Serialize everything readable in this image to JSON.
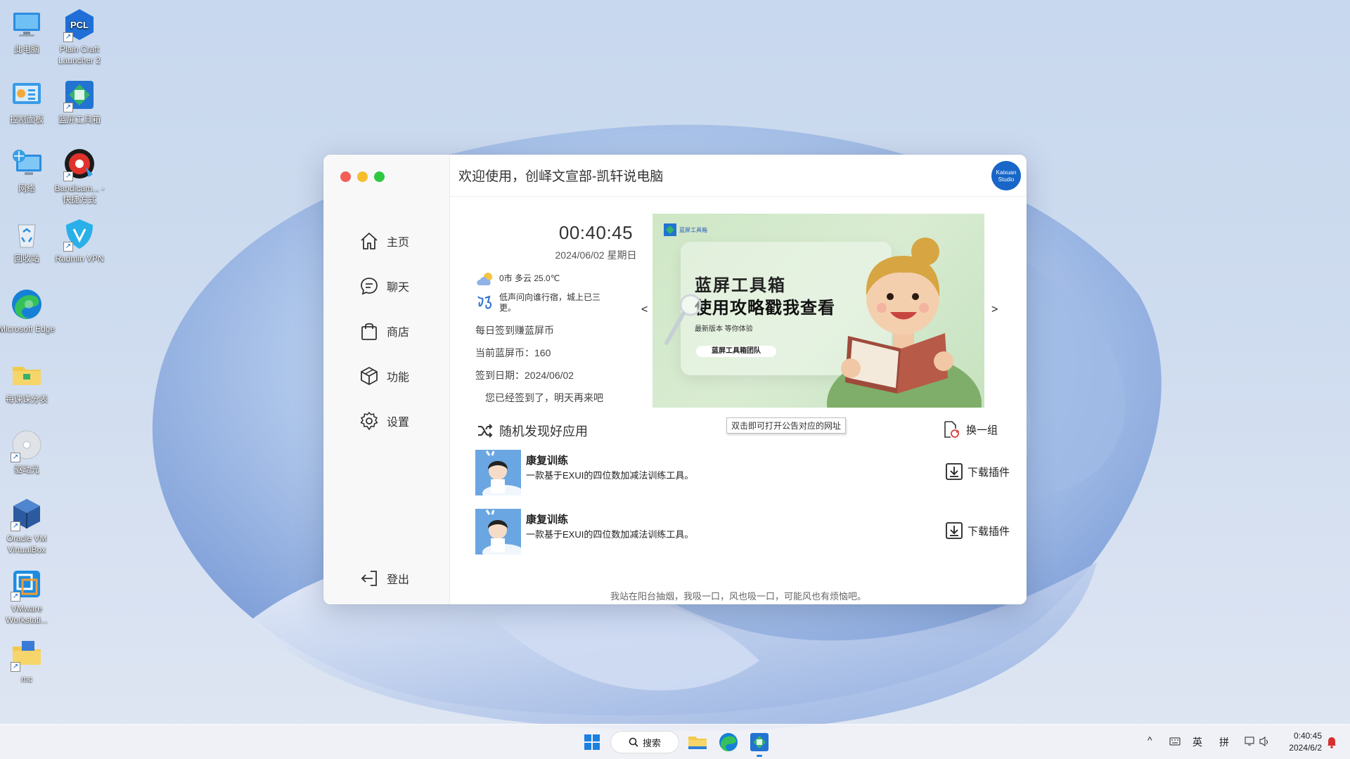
{
  "desktop": {
    "icons": [
      {
        "label": "此电脑",
        "icon": "computer-icon"
      },
      {
        "label": "Plain Craft Launcher 2",
        "icon": "pcl-icon",
        "badge": "PCL"
      },
      {
        "label": "控制面板",
        "icon": "control-panel-icon"
      },
      {
        "label": "蓝屏工具箱",
        "icon": "toolbox-icon"
      },
      {
        "label": "网络",
        "icon": "network-icon"
      },
      {
        "label": "Bandicam... - 快捷方式",
        "icon": "bandicam-icon"
      },
      {
        "label": "回收站",
        "icon": "recycle-bin-icon"
      },
      {
        "label": "Radmin VPN",
        "icon": "radmin-vpn-icon"
      },
      {
        "label": "Microsoft Edge",
        "icon": "edge-icon"
      },
      {
        "label": "每课课分表",
        "icon": "folder-icon"
      },
      {
        "label": "驱动光",
        "icon": "disc-icon"
      },
      {
        "label": "Oracle VM VirtualBox",
        "icon": "virtualbox-icon"
      },
      {
        "label": "VMware Workstati...",
        "icon": "vmware-icon"
      },
      {
        "label": "mc",
        "icon": "mc-folder-icon"
      }
    ]
  },
  "window": {
    "header_title": "欢迎使用，创峄文宣部-凯轩说电脑",
    "avatar_text": "Kaixuan Studio",
    "traffic_colors": [
      "#f25f57",
      "#f6be2e",
      "#2ec840"
    ],
    "nav": [
      {
        "label": "主页",
        "icon": "home-icon"
      },
      {
        "label": "聊天",
        "icon": "chat-icon"
      },
      {
        "label": "商店",
        "icon": "shopping-bag-icon"
      },
      {
        "label": "功能",
        "icon": "cube-icon"
      },
      {
        "label": "设置",
        "icon": "gear-icon"
      }
    ],
    "logout_label": "登出",
    "clock": "00:40:45",
    "date": "2024/06/02 星期日",
    "weather": "0市 多云 25.0℃",
    "poem": "低声问向谁行宿，城上已三更。",
    "signin_prompt": "每日签到赚蓝屏币",
    "coins": "当前蓝屏币：160",
    "signin_date": "签到日期：2024/06/02",
    "signin_status": "您已经签到了，明天再来吧",
    "banner": {
      "logo_text": "蓝屏工具箱",
      "title_line1": "蓝屏工具箱",
      "title_line2": "使用攻略戳我查看",
      "subtitle": "最新版本  等你体验",
      "team": "蓝屏工具箱团队",
      "prev": "<",
      "next": ">"
    },
    "tooltip": "双击即可打开公告对应的网址",
    "section_title": "随机发现好应用",
    "swap_label": "换一组",
    "apps": [
      {
        "name": "康复训练",
        "desc": "一款基于EXUI的四位数加减法训练工具。",
        "action": "下载插件"
      },
      {
        "name": "康复训练",
        "desc": "一款基于EXUI的四位数加减法训练工具。",
        "action": "下载插件"
      }
    ],
    "footer_quote": "我站在阳台抽烟，我吸一口，风也吸一口，可能风也有烦恼吧。"
  },
  "taskbar": {
    "search_label": "搜索",
    "tray_ime_lang": "英",
    "tray_ime_mode": "拼",
    "time": "0:40:45",
    "date": "2024/6/2"
  }
}
